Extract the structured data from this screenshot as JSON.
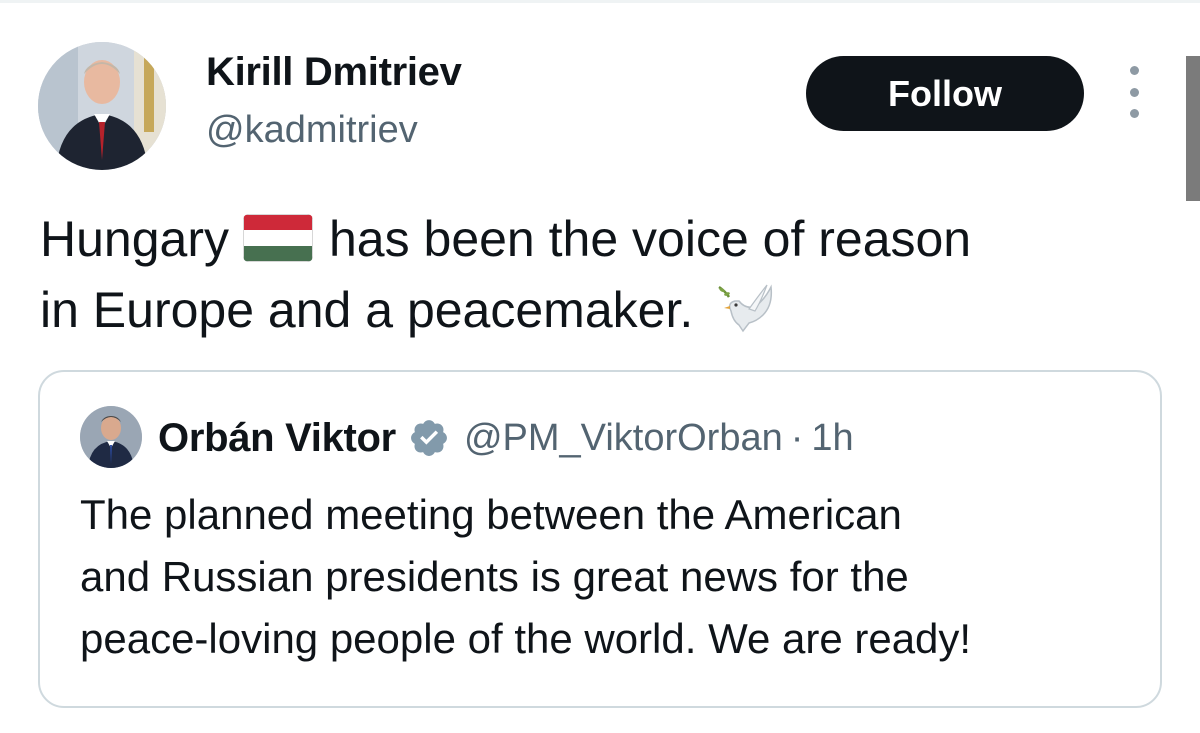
{
  "author": {
    "name": "Kirill Dmitriev",
    "handle": "@kadmitriev",
    "avatar": "profile-photo"
  },
  "actions": {
    "follow_label": "Follow",
    "more_icon": "vertical-ellipsis-icon"
  },
  "tweet": {
    "line1_before_flag": "Hungary",
    "flag_emoji": "hungary-flag-icon",
    "line1_after_flag": "has been the voice of reason",
    "line2": "in Europe and a peacemaker.",
    "trailing_emoji": "dove-icon"
  },
  "quoted_tweet": {
    "author_name": "Orbán Viktor",
    "verified": true,
    "verified_icon": "verified-badge-icon",
    "handle": "@PM_ViktorOrban",
    "separator": "·",
    "time": "1h",
    "text_lines": [
      "The planned meeting between the American",
      "and Russian presidents is great news for the",
      "peace-loving people of the world. We are ready!"
    ]
  },
  "colors": {
    "text_primary": "#0f1419",
    "text_secondary": "#536471",
    "follow_button_bg": "#0f1419",
    "card_border": "#cfd9de",
    "verified_badge": "#829aab",
    "flag_red": "#ce2939",
    "flag_white": "#ffffff",
    "flag_green": "#477050"
  }
}
